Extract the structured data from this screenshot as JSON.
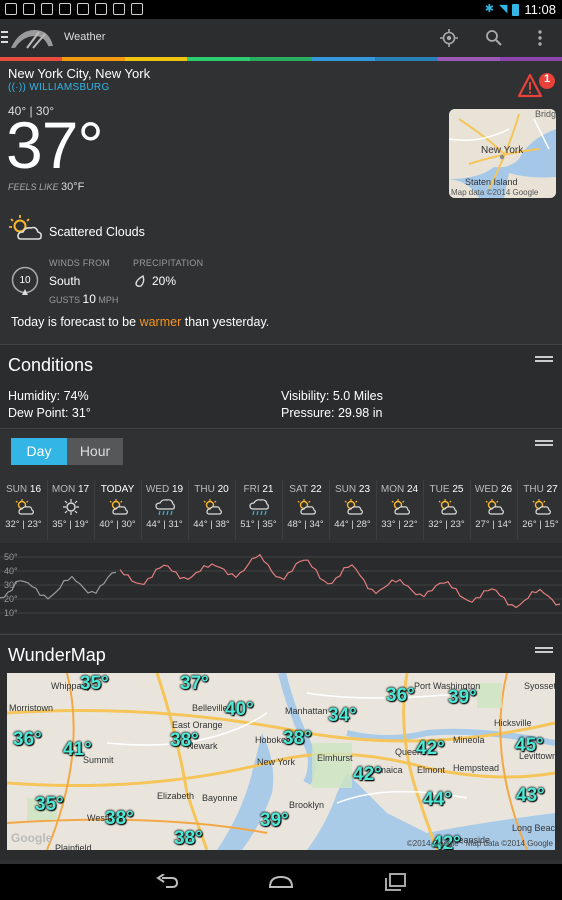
{
  "status_bar": {
    "time": "11:08"
  },
  "action_bar": {
    "title": "Weather"
  },
  "brand_colors": [
    "#e84d3d",
    "#f39c12",
    "#f1c40f",
    "#2ecc71",
    "#27ae60",
    "#3498db",
    "#2980b9",
    "#9b59b6",
    "#8e44ad"
  ],
  "location": {
    "city": "New York City, New York",
    "station": "WILLIAMSBURG"
  },
  "alert": {
    "count": "1"
  },
  "current": {
    "hi_lo": "40° | 30°",
    "temp": "37°",
    "feels_label": "FEELS LIKE",
    "feels_value": "30°F",
    "condition": "Scattered Clouds",
    "winds_label": "WINDS FROM",
    "wind_dir": "South",
    "wind_speed": "10",
    "gusts_label": "GUSTS",
    "gusts_value": "10",
    "gusts_unit": "MPH",
    "precip_label": "PRECIPITATION",
    "precip_value": "20%",
    "forecast_prefix": "Today is forecast to be",
    "forecast_word": "warmer",
    "forecast_suffix": "than yesterday."
  },
  "minimap": {
    "labels": [
      "Bridg",
      "New York",
      "Staten Island"
    ],
    "copyright": "Map data ©2014 Google"
  },
  "conditions": {
    "title": "Conditions",
    "humidity": "Humidity: 74%",
    "dew_point": "Dew Point: 31°",
    "visibility": "Visibility: 5.0 Miles",
    "pressure": "Pressure: 29.98 in"
  },
  "toggle": {
    "day": "Day",
    "hour": "Hour"
  },
  "forecast_days": [
    {
      "dow": "SUN",
      "date": "16",
      "temps": "32° | 23°",
      "icon": "partly-cloudy-icon"
    },
    {
      "dow": "MON",
      "date": "17",
      "temps": "35° | 19°",
      "icon": "sunny-icon"
    },
    {
      "dow": "TODAY",
      "date": "",
      "temps": "40° | 30°",
      "icon": "partly-cloudy-icon"
    },
    {
      "dow": "WED",
      "date": "19",
      "temps": "44° | 31°",
      "icon": "rain-icon"
    },
    {
      "dow": "THU",
      "date": "20",
      "temps": "44° | 38°",
      "icon": "partly-cloudy-icon"
    },
    {
      "dow": "FRI",
      "date": "21",
      "temps": "51° | 35°",
      "icon": "rain-icon"
    },
    {
      "dow": "SAT",
      "date": "22",
      "temps": "48° | 34°",
      "icon": "partly-cloudy-icon"
    },
    {
      "dow": "SUN",
      "date": "23",
      "temps": "44° | 28°",
      "icon": "partly-cloudy-icon"
    },
    {
      "dow": "MON",
      "date": "24",
      "temps": "33° | 22°",
      "icon": "partly-cloudy-icon"
    },
    {
      "dow": "TUE",
      "date": "25",
      "temps": "32° | 23°",
      "icon": "partly-cloudy-icon"
    },
    {
      "dow": "WED",
      "date": "26",
      "temps": "27° | 14°",
      "icon": "partly-cloudy-icon"
    },
    {
      "dow": "THU",
      "date": "27",
      "temps": "26° | 15°",
      "icon": "partly-cloudy-icon"
    }
  ],
  "graph": {
    "y_labels": [
      "50°",
      "40°",
      "30°",
      "20°",
      "10°"
    ]
  },
  "wundermap": {
    "title": "WunderMap",
    "copyright": "©2014 Google · Map data ©2014 Google",
    "google": "Google",
    "places": [
      "Whippany",
      "Morristown",
      "Summit",
      "Westfield",
      "Plainfield",
      "East Orange",
      "Newark",
      "Belleville",
      "Elizabeth",
      "Bayonne",
      "Hoboken",
      "Manhattan",
      "New York",
      "Brooklyn",
      "Elmhurst",
      "Queens",
      "Jamaica",
      "Elmont",
      "Hempstead",
      "Mineola",
      "Hicksville",
      "Port Washington",
      "Syosset",
      "Levittown",
      "Oceanside",
      "Long Beach"
    ],
    "temps": [
      "35°",
      "37°",
      "40°",
      "34°",
      "36°",
      "39°",
      "36°",
      "41°",
      "38°",
      "38°",
      "42°",
      "45°",
      "42°",
      "35°",
      "38°",
      "38°",
      "39°",
      "44°",
      "43°",
      "42°"
    ]
  }
}
